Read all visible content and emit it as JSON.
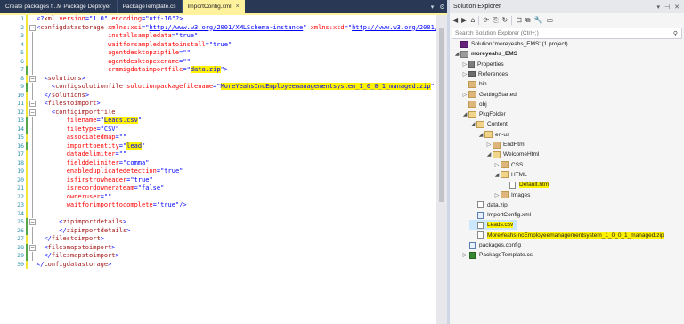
{
  "editor": {
    "tabs": [
      {
        "label": "Create packages f...M Package Deployer",
        "active": false
      },
      {
        "label": "PackageTemplate.cs",
        "active": false
      },
      {
        "label": "ImportConfig.xml",
        "active": true
      }
    ],
    "lines": [
      {
        "n": "1",
        "chg": "y",
        "ol": "",
        "html": "<span class=\"p\">&lt;?</span><span class=\"tg\">xml</span> <span class=\"at\">version</span><span class=\"p\">=\"1.0\"</span> <span class=\"at\">encoding</span><span class=\"p\">=\"utf-16\"?&gt;</span>"
      },
      {
        "n": "2",
        "chg": "y",
        "ol": "minus",
        "html": "<span class=\"p\">&lt;</span><span class=\"tg\">configdatastorage</span> <span class=\"at\">xmlns:xsi</span><span class=\"p\">=\"<span class=\"u\">http://www.w3.org/2001/XMLSchema-instance</span>\"</span> <span class=\"at\">xmlns:xsd</span><span class=\"p\">=\"<span class=\"u\">http://www.w3.org/2001/XMLSchema</span>\"</span>"
      },
      {
        "n": "3",
        "chg": "y",
        "ol": "v",
        "html": "                   <span class=\"at\">installsampledata</span><span class=\"p\">=\"true\"</span>"
      },
      {
        "n": "4",
        "chg": "y",
        "ol": "v",
        "html": "                   <span class=\"at\">waitforsampledatatoinstall</span><span class=\"p\">=\"true\"</span>"
      },
      {
        "n": "5",
        "chg": "y",
        "ol": "v",
        "html": "                   <span class=\"at\">agentdesktopzipfile</span><span class=\"p\">=\"\"</span>"
      },
      {
        "n": "6",
        "chg": "y",
        "ol": "v",
        "html": "                   <span class=\"at\">agentdesktopexename</span><span class=\"p\">=\"\"</span>"
      },
      {
        "n": "7",
        "chg": "g",
        "ol": "v",
        "html": "                   <span class=\"at\">crmmigdataimportfile</span><span class=\"p\">=\"<span class=\"hl\">data.zip</span>\"&gt;</span>"
      },
      {
        "n": "8",
        "chg": "y",
        "ol": "minus",
        "html": "  <span class=\"p\">&lt;</span><span class=\"tg\">solutions</span><span class=\"p\">&gt;</span>"
      },
      {
        "n": "9",
        "chg": "g",
        "ol": "v",
        "html": "    <span class=\"p\">&lt;</span><span class=\"tg\">configsolutionfile</span> <span class=\"at\">solutionpackagefilename</span><span class=\"p\">=\"<span class=\"hl\">MoreYeahsIncEmployeemanagementsystem_1_0_0_1_managed.zip</span>\"</span> <span class=\"p\">/&gt;</span>"
      },
      {
        "n": "10",
        "chg": "y",
        "ol": "v",
        "html": "  <span class=\"p\">&lt;/</span><span class=\"tg\">solutions</span><span class=\"p\">&gt;</span>"
      },
      {
        "n": "11",
        "chg": "y",
        "ol": "minus",
        "html": "  <span class=\"p\">&lt;</span><span class=\"tg\">filestoimport</span><span class=\"p\">&gt;</span>"
      },
      {
        "n": "12",
        "chg": "y",
        "ol": "minus",
        "html": "    <span class=\"p\">&lt;</span><span class=\"tg\">configimportfile</span>"
      },
      {
        "n": "13",
        "chg": "g",
        "ol": "v",
        "html": "        <span class=\"at\">filename</span><span class=\"p\">=\"<span class=\"hl\">Leads.csv</span>\"</span>"
      },
      {
        "n": "14",
        "chg": "g",
        "ol": "v",
        "html": "        <span class=\"at\">filetype</span><span class=\"p\">=\"CSV\"</span>"
      },
      {
        "n": "15",
        "chg": "y",
        "ol": "v",
        "html": "        <span class=\"at\">associatedmap</span><span class=\"p\">=\"\"</span>"
      },
      {
        "n": "16",
        "chg": "g",
        "ol": "v",
        "html": "        <span class=\"at\">importtoentity</span><span class=\"p\">=\"<span class=\"hl\">lead</span>\"</span>"
      },
      {
        "n": "17",
        "chg": "y",
        "ol": "v",
        "html": "        <span class=\"at\">datadelimiter</span><span class=\"p\">=\"\"</span>"
      },
      {
        "n": "18",
        "chg": "y",
        "ol": "v",
        "html": "        <span class=\"at\">fielddelimiter</span><span class=\"p\">=\"comma\"</span>"
      },
      {
        "n": "19",
        "chg": "y",
        "ol": "v",
        "html": "        <span class=\"at\">enableduplicatedetection</span><span class=\"p\">=\"true\"</span>"
      },
      {
        "n": "20",
        "chg": "y",
        "ol": "v",
        "html": "        <span class=\"at\">isfirstrowheader</span><span class=\"p\">=\"true\"</span>"
      },
      {
        "n": "21",
        "chg": "y",
        "ol": "v",
        "html": "        <span class=\"at\">isrecordownerateam</span><span class=\"p\">=\"false\"</span>"
      },
      {
        "n": "22",
        "chg": "y",
        "ol": "v",
        "html": "        <span class=\"at\">owneruser</span><span class=\"p\">=\"\"</span>"
      },
      {
        "n": "23",
        "chg": "y",
        "ol": "v",
        "html": "        <span class=\"at\">waitforimporttocomplete</span><span class=\"p\">=\"true\"/&gt;</span>"
      },
      {
        "n": "24",
        "chg": "y",
        "ol": "v",
        "html": ""
      },
      {
        "n": "25",
        "chg": "g",
        "ol": "minus",
        "html": "      <span class=\"p\">&lt;</span><span class=\"tg\">zipimportdetails</span><span class=\"p\">&gt;</span>"
      },
      {
        "n": "26",
        "chg": "g",
        "ol": "v",
        "html": "      <span class=\"p\">&lt;/</span><span class=\"tg\">zipimportdetails</span><span class=\"p\">&gt;</span>"
      },
      {
        "n": "27",
        "chg": "y",
        "ol": "v",
        "html": "  <span class=\"p\">&lt;/</span><span class=\"tg\">filestoimport</span><span class=\"p\">&gt;</span>"
      },
      {
        "n": "28",
        "chg": "g",
        "ol": "minus",
        "html": "  <span class=\"p\">&lt;</span><span class=\"tg\">filesmapstoimport</span><span class=\"p\">&gt;</span>"
      },
      {
        "n": "29",
        "chg": "g",
        "ol": "v",
        "html": "  <span class=\"p\">&lt;/</span><span class=\"tg\">filesmapstoimport</span><span class=\"p\">&gt;</span>"
      },
      {
        "n": "30",
        "chg": "y",
        "ol": "",
        "html": "<span class=\"p\">&lt;/</span><span class=\"tg\">configdatastorage</span><span class=\"p\">&gt;</span>"
      }
    ]
  },
  "solution_explorer": {
    "title": "Solution Explorer",
    "pin_icon": "pin-icon",
    "close_icon": "close-icon",
    "search_placeholder": "Search Solution Explorer (Ctrl+;)",
    "tree": [
      {
        "label": "Solution 'moreyeahs_EMS' (1 project)",
        "depth": 0,
        "icon": "sol",
        "arrow": "",
        "bold": false,
        "hl": false
      },
      {
        "label": "moreyeahs_EMS",
        "depth": 0,
        "icon": "proj",
        "arrow": "open",
        "bold": true,
        "hl": false
      },
      {
        "label": "Properties",
        "depth": 1,
        "icon": "wrench",
        "arrow": "closed",
        "bold": false,
        "hl": false
      },
      {
        "label": "References",
        "depth": 1,
        "icon": "ref",
        "arrow": "closed",
        "bold": false,
        "hl": false
      },
      {
        "label": "bin",
        "depth": 1,
        "icon": "folder",
        "arrow": "",
        "bold": false,
        "hl": false
      },
      {
        "label": "GettingStarted",
        "depth": 1,
        "icon": "folder",
        "arrow": "closed",
        "bold": false,
        "hl": false
      },
      {
        "label": "obj",
        "depth": 1,
        "icon": "folder",
        "arrow": "",
        "bold": false,
        "hl": false
      },
      {
        "label": "PkgFolder",
        "depth": 1,
        "icon": "folder open",
        "arrow": "open",
        "bold": false,
        "hl": false
      },
      {
        "label": "Content",
        "depth": 2,
        "icon": "folder open",
        "arrow": "open",
        "bold": false,
        "hl": false
      },
      {
        "label": "en-us",
        "depth": 3,
        "icon": "folder open",
        "arrow": "open",
        "bold": false,
        "hl": false
      },
      {
        "label": "EndHtml",
        "depth": 4,
        "icon": "folder",
        "arrow": "closed",
        "bold": false,
        "hl": false
      },
      {
        "label": "WelcomeHtml",
        "depth": 4,
        "icon": "folder open",
        "arrow": "open",
        "bold": false,
        "hl": false
      },
      {
        "label": "CSS",
        "depth": 5,
        "icon": "folder",
        "arrow": "closed",
        "bold": false,
        "hl": false
      },
      {
        "label": "HTML",
        "depth": 5,
        "icon": "folder open",
        "arrow": "open",
        "bold": false,
        "hl": false
      },
      {
        "label": "Default.htm",
        "depth": 6,
        "icon": "file",
        "arrow": "",
        "bold": false,
        "hl": true
      },
      {
        "label": "Images",
        "depth": 5,
        "icon": "folder",
        "arrow": "closed",
        "bold": false,
        "hl": false
      },
      {
        "label": "data.zip",
        "depth": 2,
        "icon": "file",
        "arrow": "",
        "bold": false,
        "hl": false
      },
      {
        "label": "ImportConfig.xml",
        "depth": 2,
        "icon": "xml",
        "arrow": "",
        "bold": false,
        "hl": false
      },
      {
        "label": "Leads.csv",
        "depth": 2,
        "icon": "file",
        "arrow": "",
        "bold": false,
        "hl": true,
        "selected": true
      },
      {
        "label": "MoreYeahsIncEmployeemanagementsystem_1_0_0_1_managed.zip",
        "depth": 2,
        "icon": "file",
        "arrow": "",
        "bold": false,
        "hl": true
      },
      {
        "label": "packages.config",
        "depth": 1,
        "icon": "xml",
        "arrow": "",
        "bold": false,
        "hl": false
      },
      {
        "label": "PackageTemplate.cs",
        "depth": 1,
        "icon": "cs",
        "arrow": "closed",
        "bold": false,
        "hl": false
      }
    ]
  },
  "colors": {
    "tab_bar": "#293955",
    "active_tab": "#fff29d",
    "highlight": "#fff200",
    "selection": "#cce8ff"
  }
}
